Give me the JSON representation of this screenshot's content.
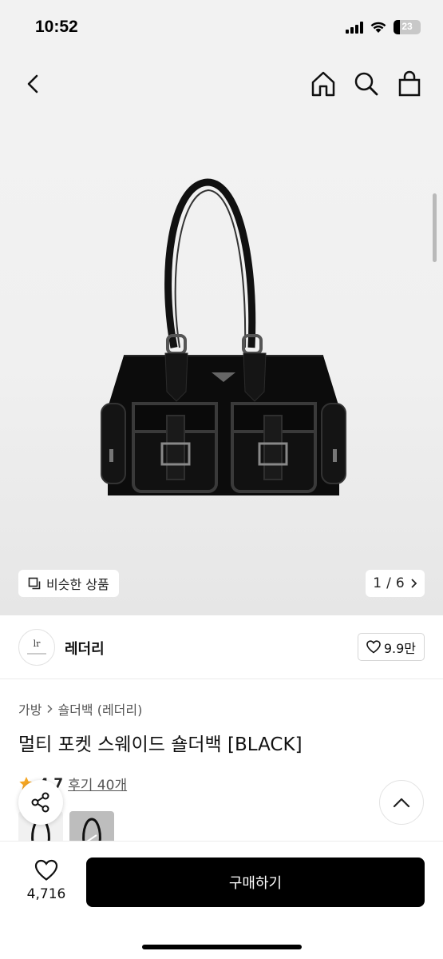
{
  "status": {
    "time": "10:52",
    "battery": "23"
  },
  "nav": {
    "icons": [
      "back-icon",
      "home-icon",
      "search-icon",
      "shopping-bag-icon"
    ]
  },
  "gallery": {
    "similar_label": "비슷한 상품",
    "page_current": "1",
    "page_total": "6",
    "page_separator": "/"
  },
  "shop": {
    "name": "레더리",
    "logo_text": "lr",
    "likes": "9.9만"
  },
  "product": {
    "breadcrumb": [
      "가방",
      "숄더백 (레더리)"
    ],
    "title": "멀티 포켓 스웨이드 숄더백 [BLACK]",
    "rating": "4.7",
    "review_label": "후기 40개"
  },
  "bottom": {
    "wish_count": "4,716",
    "buy_label": "구매하기"
  },
  "colors": {
    "accent": "#000000",
    "star": "#f5a623",
    "image_bg": "#f2f2f2"
  }
}
